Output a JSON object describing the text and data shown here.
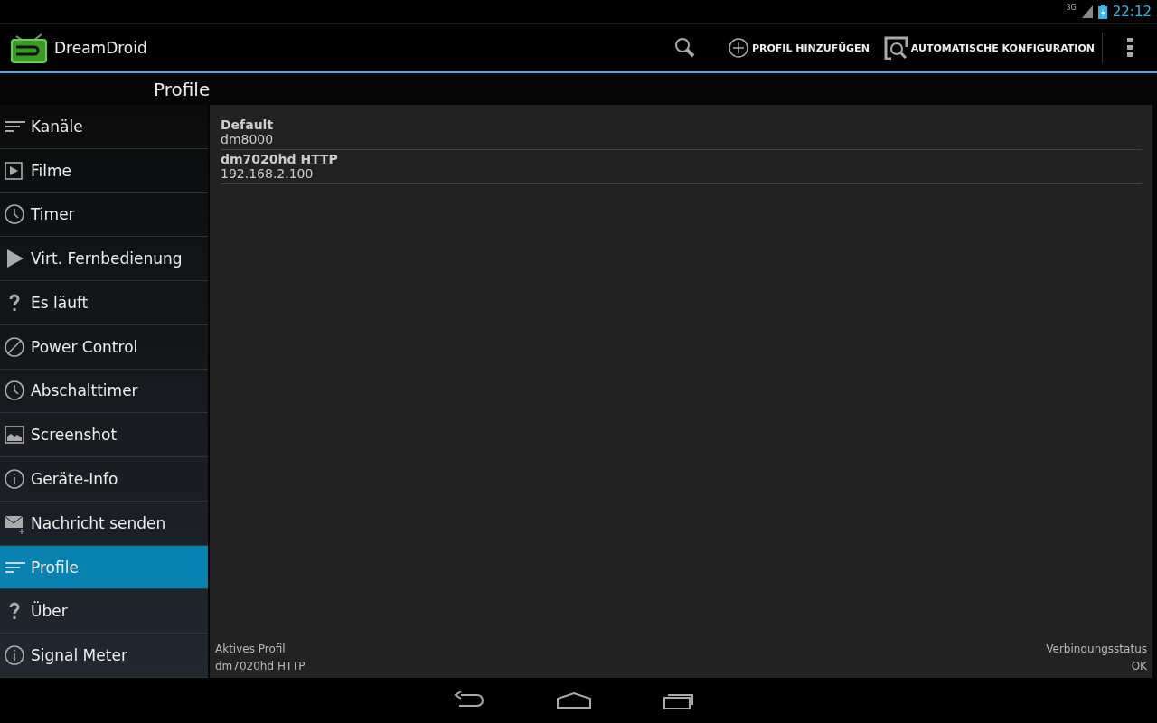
{
  "status_bar": {
    "network": "3G",
    "time": "22:12"
  },
  "app_bar": {
    "title": "DreamDroid",
    "actions": [
      {
        "kind": "search"
      },
      {
        "kind": "add",
        "label": "PROFIL HINZUFÜGEN"
      },
      {
        "kind": "autoconfig",
        "label": "AUTOMATISCHE KONFIGURATION"
      },
      {
        "kind": "overflow"
      }
    ]
  },
  "sidebar": {
    "title": "Profile",
    "items": [
      {
        "kind": "lines",
        "label": "Kanäle",
        "selected": false
      },
      {
        "kind": "film",
        "label": "Filme",
        "selected": false
      },
      {
        "kind": "clock",
        "label": "Timer",
        "selected": false
      },
      {
        "kind": "play",
        "label": "Virt. Fernbedienung",
        "selected": false
      },
      {
        "kind": "question",
        "label": "Es läuft",
        "selected": false
      },
      {
        "kind": "power",
        "label": "Power Control",
        "selected": false
      },
      {
        "kind": "clock",
        "label": "Abschalttimer",
        "selected": false
      },
      {
        "kind": "image",
        "label": "Screenshot",
        "selected": false
      },
      {
        "kind": "info",
        "label": "Geräte-Info",
        "selected": false
      },
      {
        "kind": "mail",
        "label": "Nachricht senden",
        "selected": false
      },
      {
        "kind": "lines",
        "label": "Profile",
        "selected": true
      },
      {
        "kind": "question",
        "label": "Über",
        "selected": false
      },
      {
        "kind": "info",
        "label": "Signal Meter",
        "selected": false
      }
    ]
  },
  "profiles": [
    {
      "name": "Default",
      "host": "dm8000"
    },
    {
      "name": "dm7020hd HTTP",
      "host": "192.168.2.100"
    }
  ],
  "footer": {
    "active_label": "Aktives Profil",
    "active_value": "dm7020hd HTTP",
    "status_label": "Verbindungsstatus",
    "status_value": "OK"
  }
}
